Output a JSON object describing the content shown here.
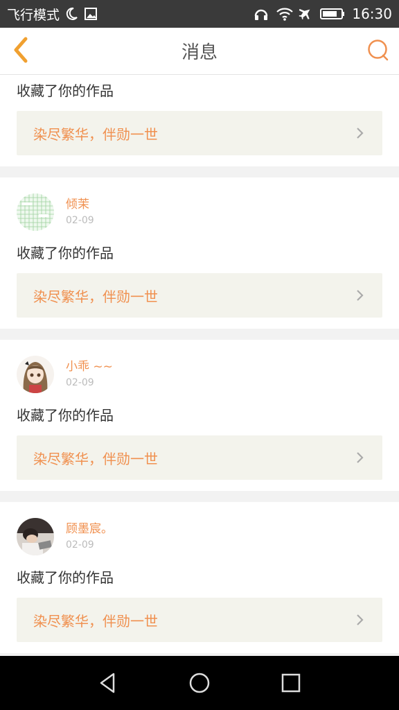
{
  "status_bar": {
    "mode": "飞行模式",
    "time": "16:30",
    "icons": [
      "moon-icon",
      "image-icon",
      "headphones-icon",
      "wifi-icon",
      "airplane-icon",
      "battery-icon"
    ]
  },
  "header": {
    "title": "消息",
    "back_icon": "chevron-left-icon",
    "search_icon": "search-icon",
    "accent_color": "#f0a030"
  },
  "messages": [
    {
      "partial": true,
      "action": "收藏了你的作品",
      "work_title": "染尽繁华，伴勋一世"
    },
    {
      "username": "倾茉",
      "date": "02-09",
      "action": "收藏了你的作品",
      "work_title": "染尽繁华，伴勋一世"
    },
    {
      "username": "小乖 ~~",
      "date": "02-09",
      "action": "收藏了你的作品",
      "work_title": "染尽繁华，伴勋一世"
    },
    {
      "username": "顾墨宸。",
      "date": "02-09",
      "action": "收藏了你的作品",
      "work_title": "染尽繁华，伴勋一世"
    }
  ],
  "nav_bar": {
    "icons": [
      "back-triangle-icon",
      "home-circle-icon",
      "recents-square-icon"
    ]
  },
  "colors": {
    "name_text": "#f0904f",
    "work_bg": "#f3f3ec",
    "status_bg": "#3a3a3a"
  }
}
